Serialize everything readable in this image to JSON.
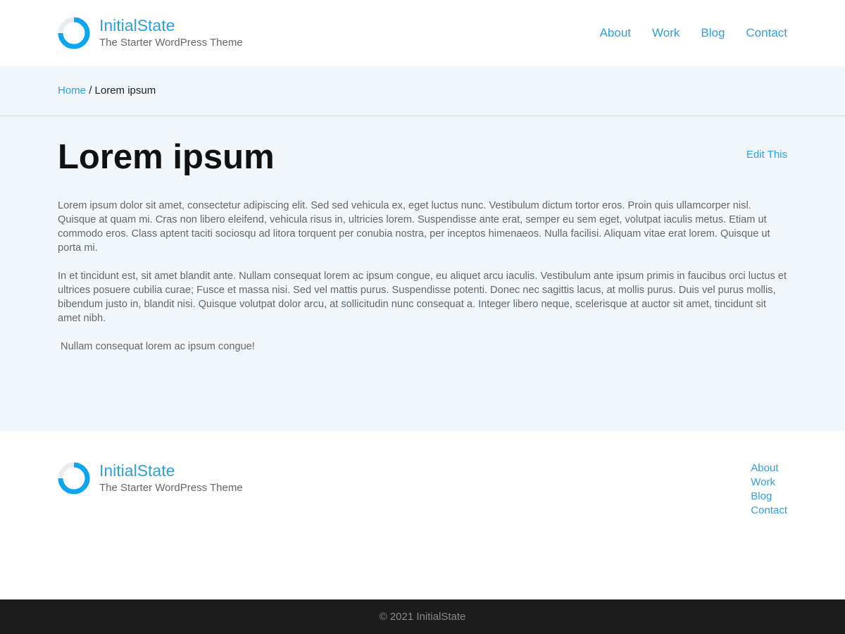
{
  "colors": {
    "accent": "#2f9fdf",
    "content_background": "#f0f6fa",
    "footer_bar": "#1c1c1c"
  },
  "header": {
    "logo_icon": "ring-logo-icon",
    "site_title": "InitialState",
    "tagline": "The Starter WordPress Theme",
    "nav": [
      "About",
      "Work",
      "Blog",
      "Contact"
    ]
  },
  "breadcrumb": {
    "home": "Home",
    "separator": "/",
    "current": "Lorem ipsum"
  },
  "page": {
    "title": "Lorem ipsum",
    "edit_link": "Edit This",
    "paragraphs": [
      "Lorem ipsum dolor sit amet, consectetur adipiscing elit. Sed sed vehicula ex, eget luctus nunc. Vestibulum dictum tortor eros. Proin quis ullamcorper nisl. Quisque at quam mi. Cras non libero eleifend, vehicula risus in, ultricies lorem. Suspendisse ante erat, semper eu sem eget, volutpat iaculis metus. Etiam ut commodo eros. Class aptent taciti sociosqu ad litora torquent per conubia nostra, per inceptos himenaeos. Nulla facilisi. Aliquam vitae erat lorem. Quisque ut porta mi.",
      "In et tincidunt est, sit amet blandit ante. Nullam consequat lorem ac ipsum congue, eu aliquet arcu iaculis. Vestibulum ante ipsum primis in faucibus orci luctus et ultrices posuere cubilia curae; Fusce et massa nisi. Sed vel mattis purus. Suspendisse potenti. Donec nec sagittis lacus, at mollis purus. Duis vel purus mollis, bibendum justo in, blandit nisi. Quisque volutpat dolor arcu, at sollicitudin nunc consequat a. Integer libero neque, scelerisque at auctor sit amet, tincidunt sit amet nibh.",
      " Nullam consequat lorem ac ipsum congue!"
    ]
  },
  "footer": {
    "logo_icon": "ring-logo-icon",
    "site_title": "InitialState",
    "tagline": "The Starter WordPress Theme",
    "nav": [
      "About",
      "Work",
      "Blog",
      "Contact"
    ],
    "copyright": "© 2021 InitialState"
  }
}
